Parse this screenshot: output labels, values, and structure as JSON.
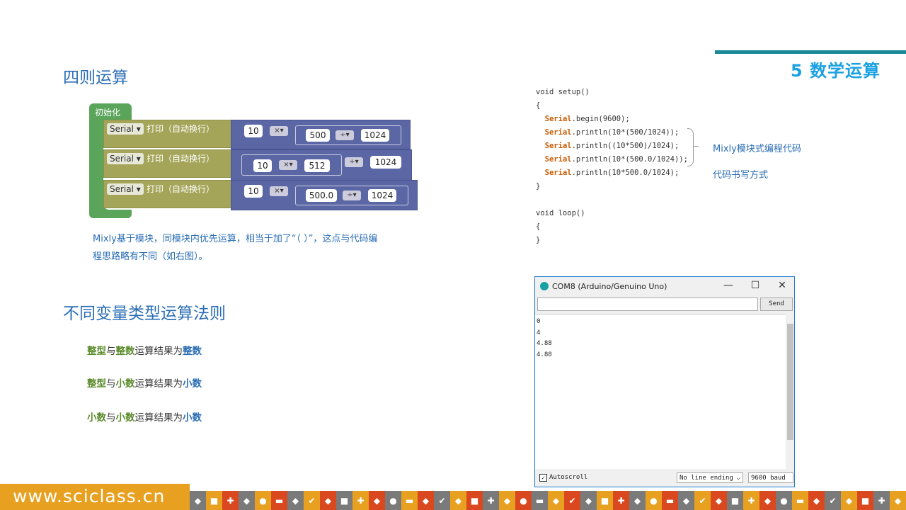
{
  "header": {
    "slide_title": "5 数学运算"
  },
  "section1": {
    "heading": "四则运算",
    "init_label": "初始化",
    "rows": [
      {
        "serial": "Serial",
        "print": "打印（自动换行）",
        "a": "10",
        "op1": "×",
        "b": "500",
        "op2": "÷",
        "c": "1024"
      },
      {
        "serial": "Serial",
        "print": "打印（自动换行）",
        "a": "10",
        "op1": "×",
        "b": "512",
        "op2": "÷",
        "c": "1024"
      },
      {
        "serial": "Serial",
        "print": "打印（自动换行）",
        "a": "10",
        "op1": "×",
        "b": "500.0",
        "op2": "÷",
        "c": "1024"
      }
    ],
    "desc_line1": "Mixly基于模块，同模块内优先运算，相当于加了“（  ）”，这点与代码编",
    "desc_line2": "程思路略有不同（如右图）。"
  },
  "section2": {
    "heading": "不同变量类型运算法则",
    "rules": [
      {
        "a": "整型",
        "mid": "与",
        "b": "整数",
        "rest": "运算结果为",
        "res": "整数"
      },
      {
        "a": "整型",
        "mid": "与",
        "b": "小数",
        "rest": "运算结果为",
        "res": "小数"
      },
      {
        "a": "小数",
        "mid": "与",
        "b": "小数",
        "rest": "运算结果为",
        "res": "小数"
      }
    ]
  },
  "code": {
    "setup_sig": "void setup()",
    "open": "{",
    "close": "}",
    "lines": [
      {
        "obj": "Serial",
        "call": ".begin(9600);"
      },
      {
        "obj": "Serial",
        "call": ".println(10*(500/1024));"
      },
      {
        "obj": "Serial",
        "call": ".println((10*500)/1024);"
      },
      {
        "obj": "Serial",
        "call": ".println(10*(500.0/1024));"
      },
      {
        "obj": "Serial",
        "call": ".println(10*500.0/1024);"
      }
    ],
    "loop_sig": "void loop()",
    "note1": "Mixly模块式编程代码",
    "note2": "代码书写方式"
  },
  "monitor": {
    "title": "COM8 (Arduino/Genuino Uno)",
    "send_label": "Send",
    "output": [
      "0",
      "4",
      "4.88",
      "4.88"
    ],
    "autoscroll": "Autoscroll",
    "line_ending": "No line ending",
    "baud": "9600 baud"
  },
  "footer": {
    "url": "www.sciclass.cn"
  }
}
